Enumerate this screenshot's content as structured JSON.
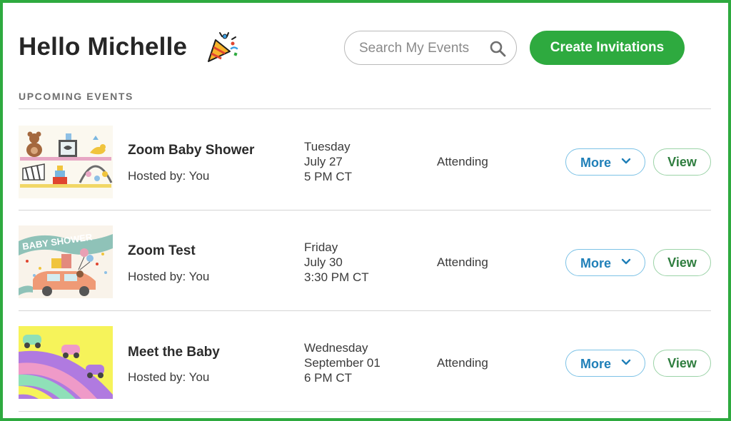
{
  "header": {
    "greeting": "Hello Michelle",
    "party_icon": "party-popper-icon",
    "search": {
      "placeholder": "Search My Events",
      "value": ""
    },
    "create_label": "Create Invitations"
  },
  "section_label": "UPCOMING EVENTS",
  "colors": {
    "accent_green": "#2eaa3f",
    "more_blue": "#1f7fb8",
    "view_green": "#2e7d3e"
  },
  "events": [
    {
      "title": "Zoom Baby Shower",
      "host": "Hosted by: You",
      "day": "Tuesday",
      "date": "July 27",
      "time": "5 PM CT",
      "status": "Attending",
      "more_label": "More",
      "view_label": "View",
      "thumbnail": "baby-shelf-toys-thumbnail"
    },
    {
      "title": "Zoom Test",
      "host": "Hosted by: You",
      "day": "Friday",
      "date": "July 30",
      "time": "3:30 PM CT",
      "status": "Attending",
      "more_label": "More",
      "view_label": "View",
      "thumbnail": "baby-shower-car-thumbnail",
      "thumbnail_text": "BABY SHOWER"
    },
    {
      "title": "Meet the Baby",
      "host": "Hosted by: You",
      "day": "Wednesday",
      "date": "September 01",
      "time": "6 PM CT",
      "status": "Attending",
      "more_label": "More",
      "view_label": "View",
      "thumbnail": "rainbow-cars-thumbnail"
    }
  ]
}
